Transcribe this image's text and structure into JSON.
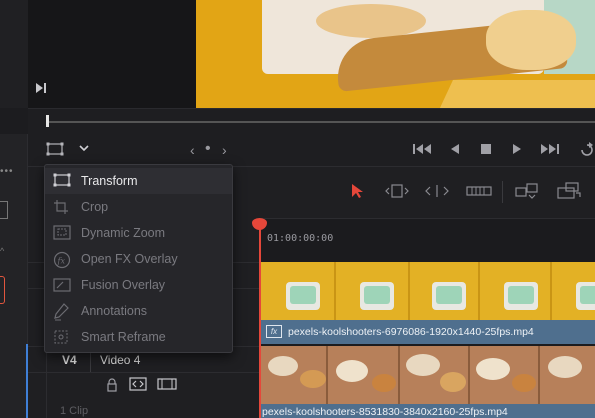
{
  "viewer": {
    "transform_tool_icon": "transform-rect-icon",
    "frame_end_icon": "frame-end-icon"
  },
  "transport": {
    "nav_prev": "‹",
    "nav_dot": "•",
    "nav_next": "›",
    "icons": [
      "skip-back-icon",
      "play-reverse-icon",
      "stop-icon",
      "play-icon",
      "skip-forward-icon",
      "loop-icon"
    ]
  },
  "overlay_menu": {
    "items": [
      {
        "label": "Transform",
        "icon": "transform-icon",
        "state": "active"
      },
      {
        "label": "Crop",
        "icon": "crop-icon",
        "state": "dim"
      },
      {
        "label": "Dynamic Zoom",
        "icon": "dynamic-zoom-icon",
        "state": "dim"
      },
      {
        "label": "Open FX Overlay",
        "icon": "fx-icon",
        "state": "dim"
      },
      {
        "label": "Fusion Overlay",
        "icon": "fusion-overlay-icon",
        "state": "dim"
      },
      {
        "label": "Annotations",
        "icon": "annotation-pen-icon",
        "state": "dim"
      },
      {
        "label": "Smart Reframe",
        "icon": "smart-reframe-icon",
        "state": "dim"
      }
    ]
  },
  "timeline": {
    "timecode": "01:00:00:00",
    "toolbar_icons": [
      "selection-arrow-icon",
      "trim-edit-icon",
      "dynamic-trim-icon",
      "blade-icon",
      "insert-clip-icon",
      "overwrite-clip-icon"
    ],
    "playhead_color": "#e5473a"
  },
  "tracks": {
    "v4": {
      "label": "V4",
      "name": "Video 4",
      "clip_count": "1 Clip"
    },
    "clips": [
      {
        "name": "pexels-koolshooters-6976086-1920x1440-25fps.mp4",
        "fx_badge": "fx"
      },
      {
        "name": "pexels-koolshooters-8531830-3840x2160-25fps.mp4"
      }
    ]
  },
  "colors": {
    "clip_blue": "#4f6f8e",
    "accent_red": "#e5473a",
    "selection_blue": "#3f7fd6"
  }
}
